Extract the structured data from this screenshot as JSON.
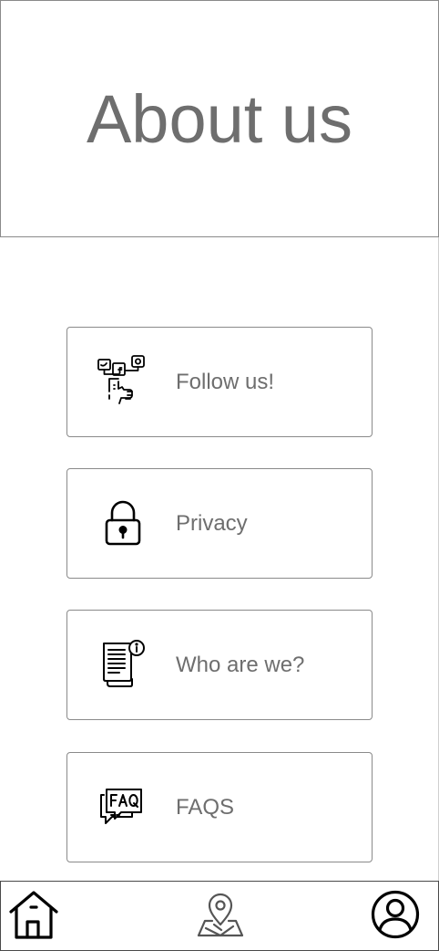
{
  "header": {
    "title": "About us"
  },
  "menu": {
    "items": [
      {
        "label": "Follow us!",
        "icon": "social-media-hand-icon"
      },
      {
        "label": "Privacy",
        "icon": "padlock-icon"
      },
      {
        "label": "Who are we?",
        "icon": "document-info-icon"
      },
      {
        "label": "FAQS",
        "icon": "faq-chat-icon"
      }
    ]
  },
  "bottom_nav": {
    "items": [
      {
        "icon": "home-icon"
      },
      {
        "icon": "map-pin-icon"
      },
      {
        "icon": "user-profile-icon"
      }
    ]
  },
  "colors": {
    "text": "#6e6e6e",
    "border": "#8a8a8a",
    "icon": "#000000"
  }
}
